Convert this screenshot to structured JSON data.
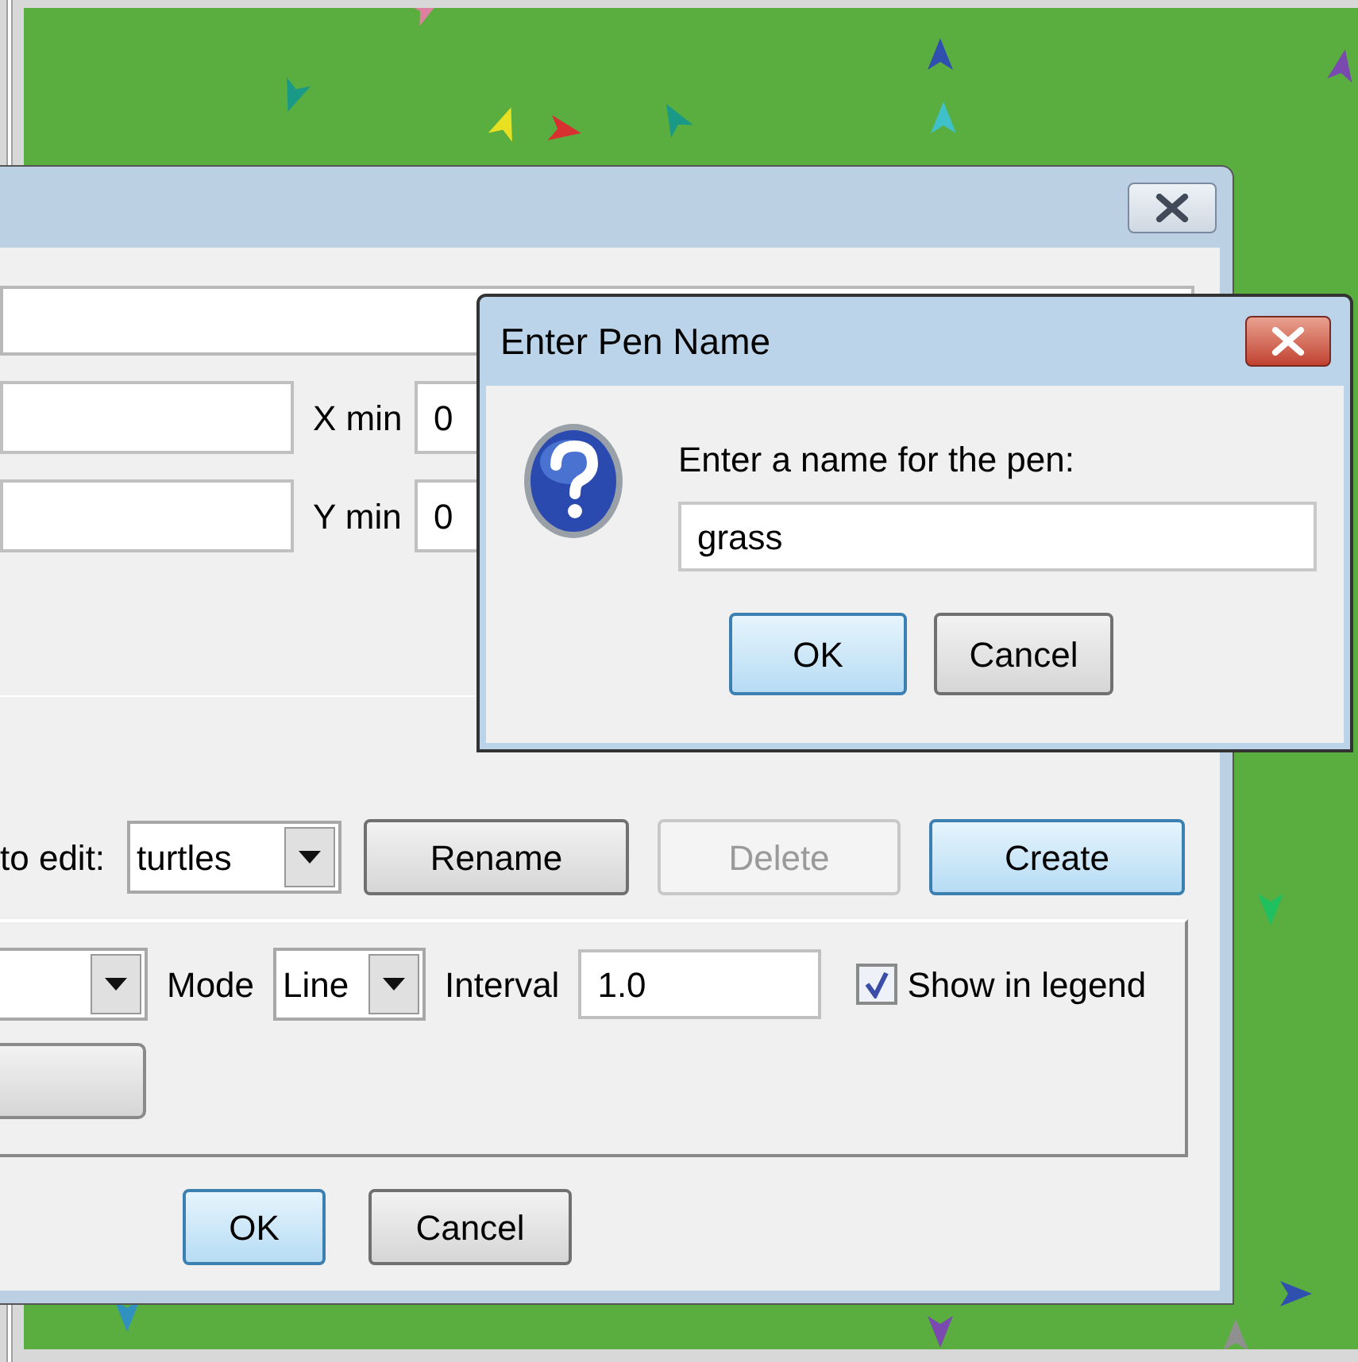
{
  "plot_dialog": {
    "fields": [
      {
        "label": "X min",
        "value": "0"
      },
      {
        "label": "Y min",
        "value": "0"
      }
    ],
    "pen_selector": {
      "label": "to edit:",
      "value": "turtles"
    },
    "buttons": [
      {
        "label": "Rename",
        "disabled": false,
        "highlighted": false
      },
      {
        "label": "Delete",
        "disabled": true,
        "highlighted": false
      },
      {
        "label": "Create",
        "disabled": false,
        "highlighted": true
      }
    ],
    "pen_settings": {
      "mode_label": "Mode",
      "mode": "Line",
      "interval_label": "Interval",
      "interval": "1.0",
      "legend_label": "Show in legend",
      "show_in_legend": true
    },
    "footer_buttons": [
      {
        "label": "OK",
        "highlighted": true
      },
      {
        "label": "Cancel",
        "highlighted": false
      }
    ]
  },
  "pen_name_dialog": {
    "title": "Enter Pen Name",
    "prompt": "Enter a name for the pen:",
    "value": "grass",
    "buttons": [
      {
        "label": "OK",
        "highlighted": true
      },
      {
        "label": "Cancel",
        "highlighted": false
      }
    ]
  }
}
